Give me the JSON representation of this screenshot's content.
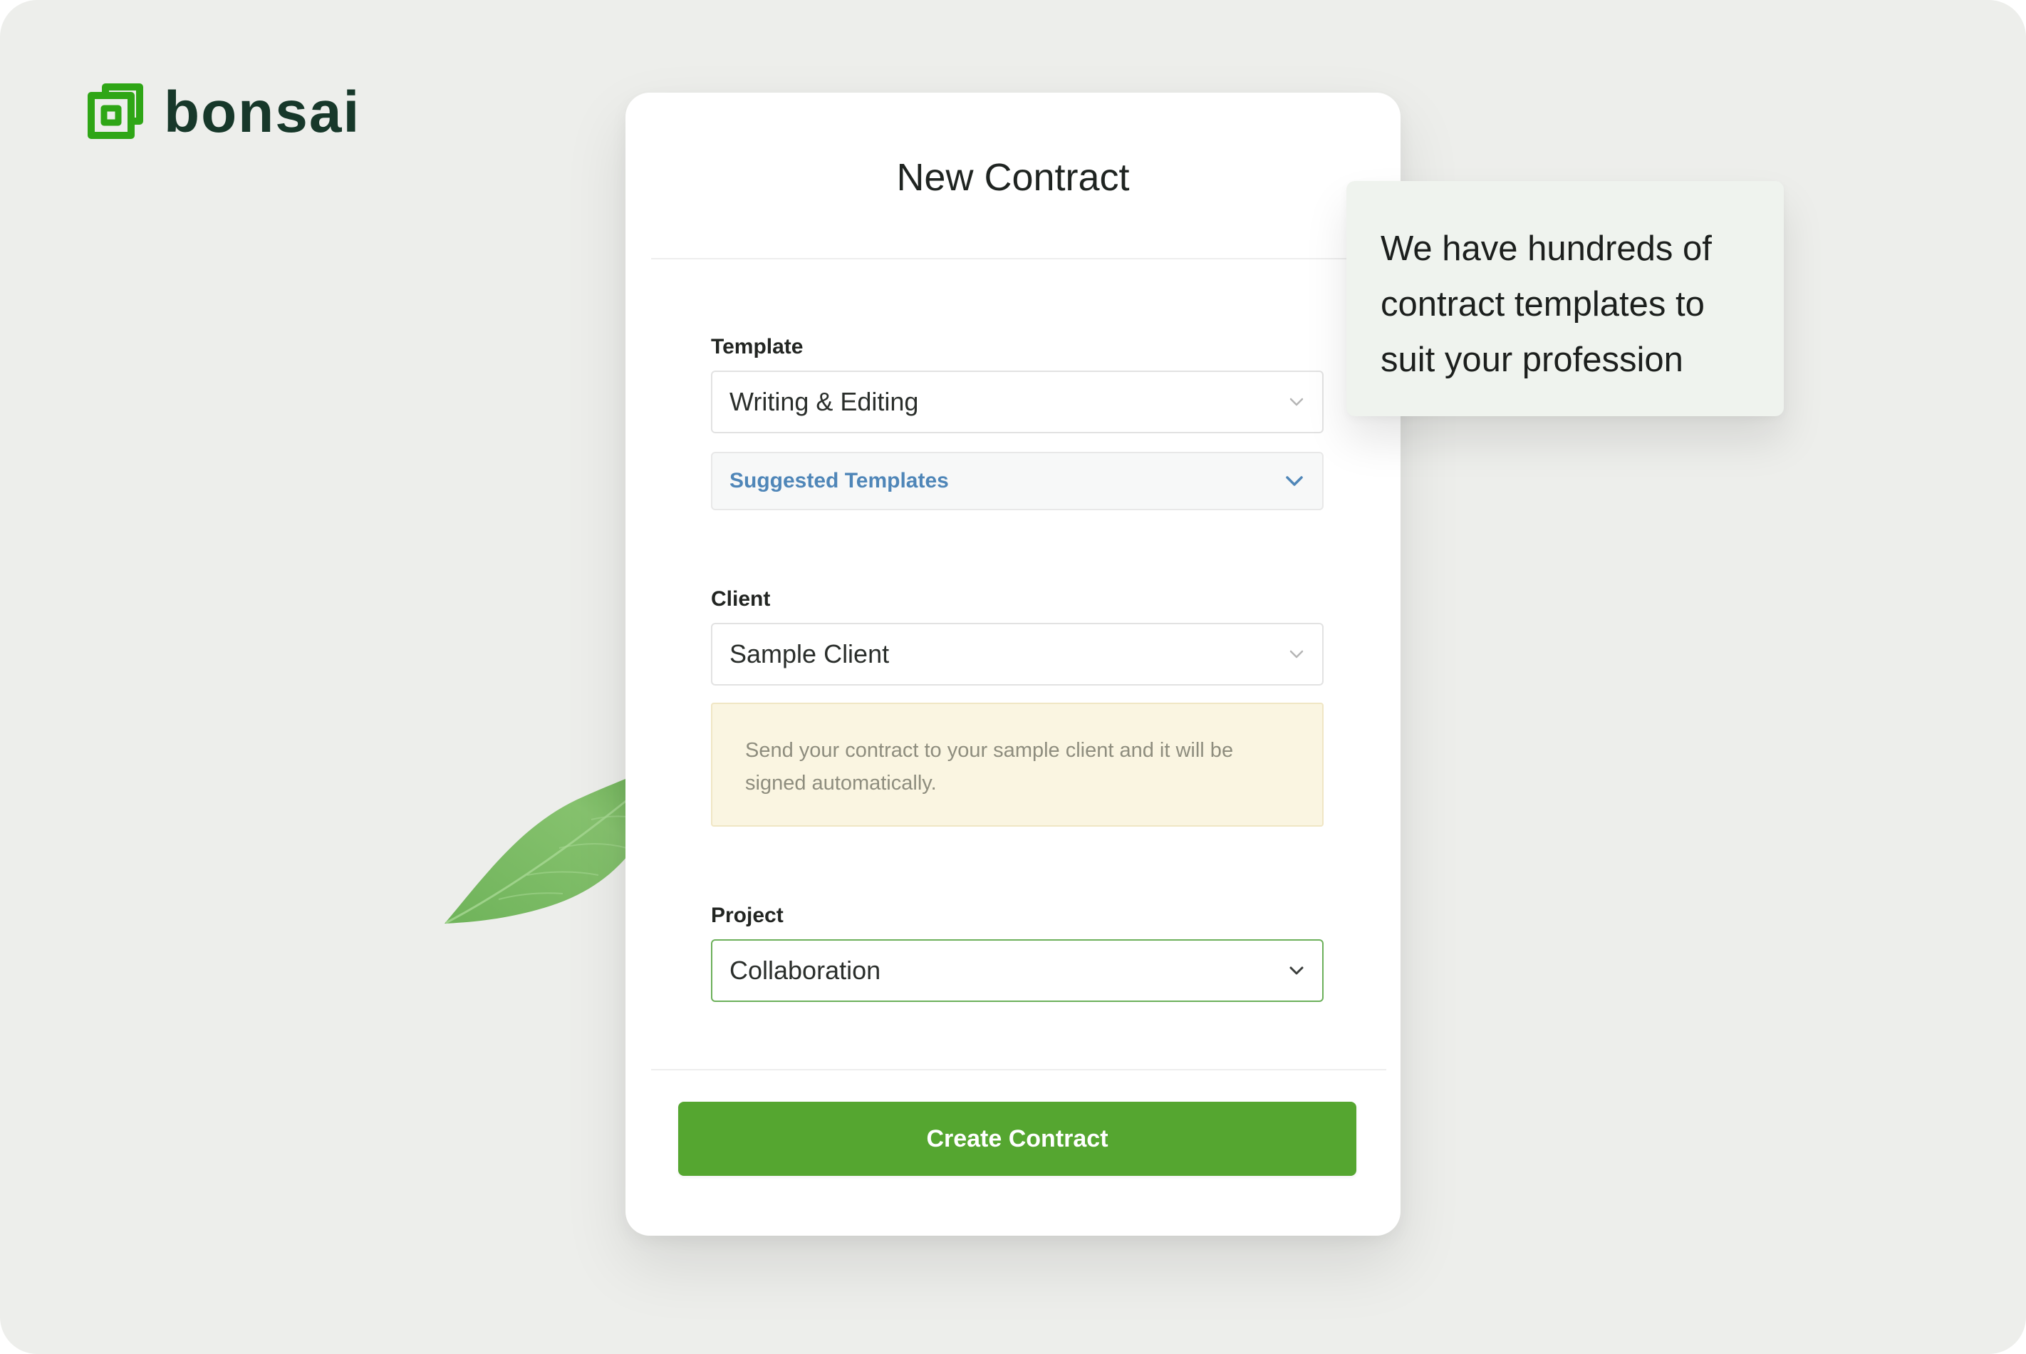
{
  "brand": {
    "name": "bonsai",
    "color": "#2fa616",
    "text_color": "#17382a"
  },
  "form": {
    "title": "New Contract",
    "template": {
      "label": "Template",
      "value": "Writing & Editing",
      "suggested_label": "Suggested Templates"
    },
    "client": {
      "label": "Client",
      "value": "Sample Client",
      "notice": "Send your contract to your sample client and it will be signed automatically."
    },
    "project": {
      "label": "Project",
      "value": "Collaboration"
    },
    "submit_label": "Create Contract"
  },
  "callout": {
    "text": "We have hundreds of contract templates to suit your profession"
  },
  "colors": {
    "accent_green": "#55a630",
    "link_blue": "#4f86b8",
    "notice_bg": "#faf5e1",
    "project_border": "#6cb05a"
  },
  "icons": {
    "logo": "bonsai-logo-icon",
    "dropdown": "chevron-down-icon",
    "decoration": "leaf-icon"
  }
}
